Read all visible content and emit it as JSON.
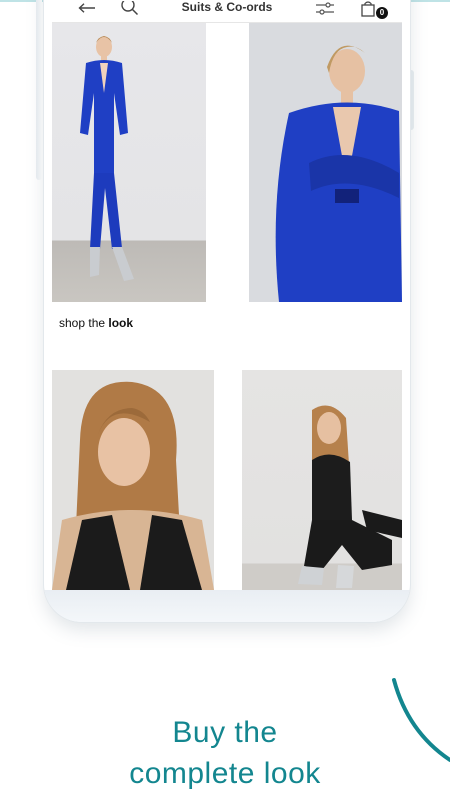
{
  "header": {
    "title": "Suits & Co-ords",
    "back_icon": "arrow-left-icon",
    "search_icon": "search-icon",
    "filter_icon": "sliders-icon",
    "cart_icon": "shopping-bag-icon",
    "cart_count": "0"
  },
  "products": [
    {
      "id": "product-1",
      "description": "model in cobalt blue blazer and trousers, silver boots"
    },
    {
      "id": "product-2",
      "description": "close-up of cobalt blue blazer, arms crossed"
    },
    {
      "id": "product-3",
      "description": "model with long hair in black waistcoat"
    },
    {
      "id": "product-4",
      "description": "model crouching in black top and trousers"
    }
  ],
  "shop_look": {
    "prefix": "shop the",
    "emphasis": "look"
  },
  "promo": {
    "line1": "Buy the",
    "line2": "complete look"
  },
  "colors": {
    "accent": "#13868f",
    "product_blue": "#1f3fc4"
  }
}
